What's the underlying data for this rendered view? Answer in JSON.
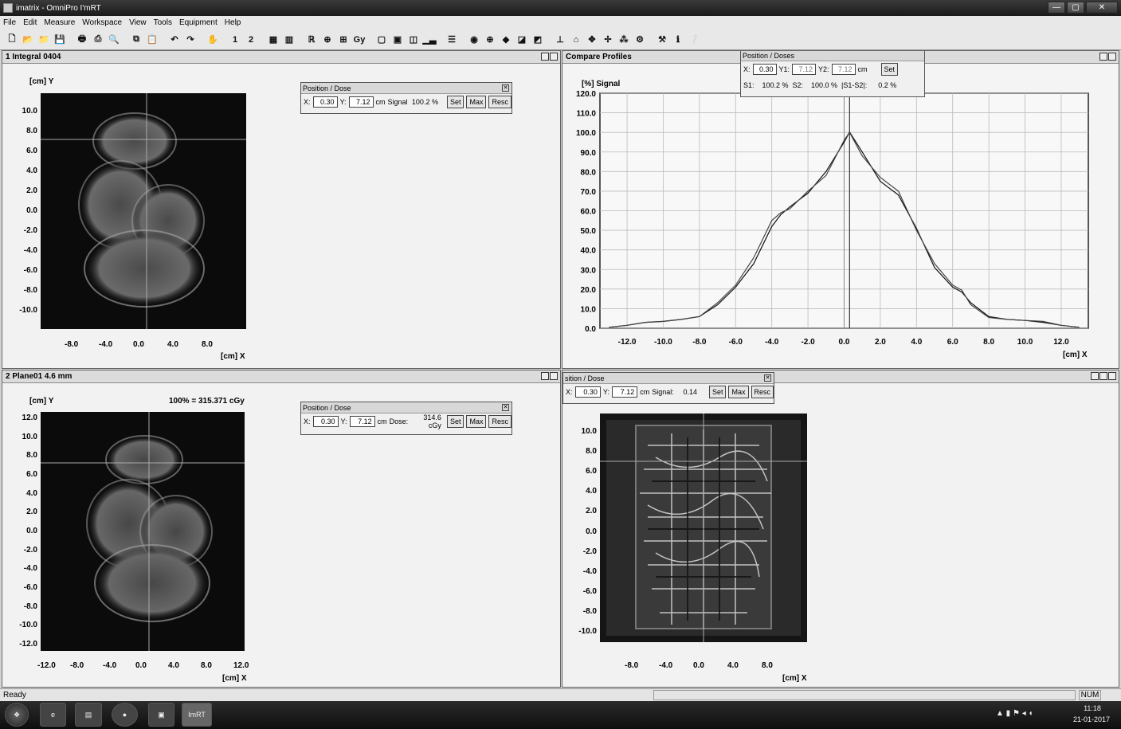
{
  "window": {
    "title": "imatrix - OmniPro I'mRT",
    "min": "—",
    "max": "▢",
    "close": "✕"
  },
  "menu": [
    "File",
    "Edit",
    "Measure",
    "Workspace",
    "View",
    "Tools",
    "Equipment",
    "Help"
  ],
  "toolbar": {
    "icons": [
      "new-icon",
      "open-icon",
      "open2-icon",
      "save-icon",
      "sep",
      "print-icon",
      "print2-icon",
      "printpreview-icon",
      "sep",
      "copy-icon",
      "paste-icon",
      "sep",
      "undo-icon",
      "redo-icon",
      "sep",
      "hand-icon",
      "sep",
      "one",
      "two",
      "sep",
      "layout1-icon",
      "layout2-icon",
      "sep",
      "roi-icon",
      "zoom-icon",
      "prof-icon",
      "gy-icon",
      "sep",
      "tool1-icon",
      "tool2-icon",
      "tool3-icon",
      "histogram-icon",
      "sep",
      "list-icon",
      "sep",
      "target-icon",
      "globe-icon",
      "shape-icon",
      "chart-icon",
      "chart2-icon",
      "sep",
      "measure-icon",
      "measure2-icon",
      "move-icon",
      "arrows-icon",
      "compare-icon",
      "gear-icon",
      "sep",
      "tools-icon",
      "info-icon",
      "help-icon"
    ],
    "one": "1",
    "two": "2",
    "gy": "Gy"
  },
  "panes": {
    "p1": {
      "num": "1",
      "title": "Integral 0404",
      "ylabel": "[cm] Y",
      "xlabel": "[cm] X",
      "pos": {
        "title": "Position / Dose",
        "x_label": "X:",
        "x": "0.30",
        "y_label": "Y:",
        "y": "7.12",
        "unit": "cm",
        "kind": "Signal",
        "val": "100.2 %",
        "set": "Set",
        "max": "Max",
        "resc": "Resc"
      },
      "yticks": [
        "10.0",
        "8.0",
        "6.0",
        "4.0",
        "2.0",
        "0.0",
        "-2.0",
        "-4.0",
        "-6.0",
        "-8.0",
        "-10.0"
      ],
      "xticks": [
        "-8.0",
        "-4.0",
        "0.0",
        "4.0",
        "8.0"
      ]
    },
    "p2": {
      "num": "",
      "title": "Compare Profiles",
      "ylabel": "[%] Signal",
      "xlabel": "[cm] X",
      "pos": {
        "title": "Position / Doses",
        "x_label": "X:",
        "x": "0.30",
        "y1_label": "Y1:",
        "y1": "7.12",
        "y2_label": "Y2:",
        "y2": "7.12",
        "unit": "cm",
        "set": "Set",
        "s1_label": "S1:",
        "s1": "100.2 %",
        "s2_label": "S2:",
        "s2": "100.0 %",
        "diff_label": "|S1-S2|:",
        "diff": "0.2 %"
      }
    },
    "p3": {
      "num": "2",
      "title": "Plane01 4.6 mm",
      "ylabel": "[cm] Y",
      "xlabel": "[cm] X",
      "norm": "100% = 315.371 cGy",
      "pos": {
        "title": "Position / Dose",
        "x_label": "X:",
        "x": "0.30",
        "y_label": "Y:",
        "y": "7.12",
        "unit": "cm",
        "kind": "Dose:",
        "val": "314.6 cGy",
        "set": "Set",
        "max": "Max",
        "resc": "Resc"
      },
      "yticks": [
        "12.0",
        "10.0",
        "8.0",
        "6.0",
        "4.0",
        "2.0",
        "0.0",
        "-2.0",
        "-4.0",
        "-6.0",
        "-8.0",
        "-10.0",
        "-12.0"
      ],
      "xticks": [
        "-12.0",
        "-8.0",
        "-4.0",
        "0.0",
        "4.0",
        "8.0",
        "12.0"
      ]
    },
    "p4": {
      "xlabel": "[cm] X",
      "pos": {
        "title": "sition / Dose",
        "x_label": "X:",
        "x": "0.30",
        "y_label": "Y:",
        "y": "7.12",
        "unit": "cm",
        "kind": "Signal:",
        "val": "0.14",
        "set": "Set",
        "max": "Max",
        "resc": "Resc"
      },
      "yticks": [
        "10.0",
        "8.0",
        "6.0",
        "4.0",
        "2.0",
        "0.0",
        "-2.0",
        "-4.0",
        "-6.0",
        "-8.0",
        "-10.0"
      ],
      "xticks": [
        "-8.0",
        "-4.0",
        "0.0",
        "4.0",
        "8.0"
      ]
    }
  },
  "chart_data": {
    "type": "line",
    "xlabel": "[cm] X",
    "ylabel": "[%] Signal",
    "xlim": [
      -13.5,
      13.5
    ],
    "ylim": [
      0,
      120
    ],
    "xticks": [
      "-12.0",
      "-10.0",
      "-8.0",
      "-6.0",
      "-4.0",
      "-2.0",
      "0.0",
      "2.0",
      "4.0",
      "6.0",
      "8.0",
      "10.0",
      "12.0"
    ],
    "yticks": [
      "0.0",
      "10.0",
      "20.0",
      "30.0",
      "40.0",
      "50.0",
      "60.0",
      "70.0",
      "80.0",
      "90.0",
      "100.0",
      "110.0",
      "120.0"
    ],
    "grid": true,
    "series": [
      {
        "x": [
          -13.0,
          -12.0,
          -11.0,
          -10.0,
          -9.0,
          -8.0,
          -7.0,
          -6.0,
          -5.0,
          -4.0,
          -3.5,
          -3.0,
          -2.0,
          -1.0,
          0.0,
          0.3,
          1.0,
          2.0,
          3.0,
          4.0,
          5.0,
          6.0,
          6.5,
          7.0,
          8.0,
          9.0,
          10.0,
          11.0,
          12.0,
          13.0
        ],
        "y": [
          0.5,
          1.5,
          3.0,
          3.5,
          4.5,
          6.0,
          12.0,
          21.0,
          33.0,
          52.0,
          58.0,
          62.0,
          69.0,
          80.0,
          95.0,
          100.2,
          90.0,
          75.0,
          68.0,
          51.0,
          31.0,
          21.0,
          18.5,
          13.0,
          6.0,
          4.5,
          4.0,
          3.0,
          1.5,
          0.5
        ]
      },
      {
        "x": [
          -13.0,
          -12.0,
          -11.0,
          -10.0,
          -9.0,
          -8.0,
          -7.0,
          -6.0,
          -5.0,
          -4.0,
          -3.5,
          -3.0,
          -2.0,
          -1.0,
          0.0,
          0.3,
          1.0,
          2.0,
          3.0,
          4.0,
          5.0,
          6.0,
          6.5,
          7.0,
          8.0,
          9.0,
          10.0,
          11.0,
          12.0,
          13.0
        ],
        "y": [
          0.5,
          1.5,
          3.0,
          3.5,
          4.5,
          6.0,
          13.0,
          22.0,
          36.0,
          55.0,
          59.0,
          61.0,
          70.0,
          78.0,
          96.0,
          100.0,
          88.0,
          77.0,
          70.0,
          50.0,
          33.0,
          22.0,
          19.5,
          12.0,
          5.5,
          4.5,
          4.0,
          3.5,
          1.5,
          0.5
        ]
      }
    ]
  },
  "status": {
    "left": "Ready",
    "num": "NUM"
  },
  "taskbar": {
    "imrt": "ImRT",
    "time": "11:18",
    "date": "21-01-2017"
  }
}
